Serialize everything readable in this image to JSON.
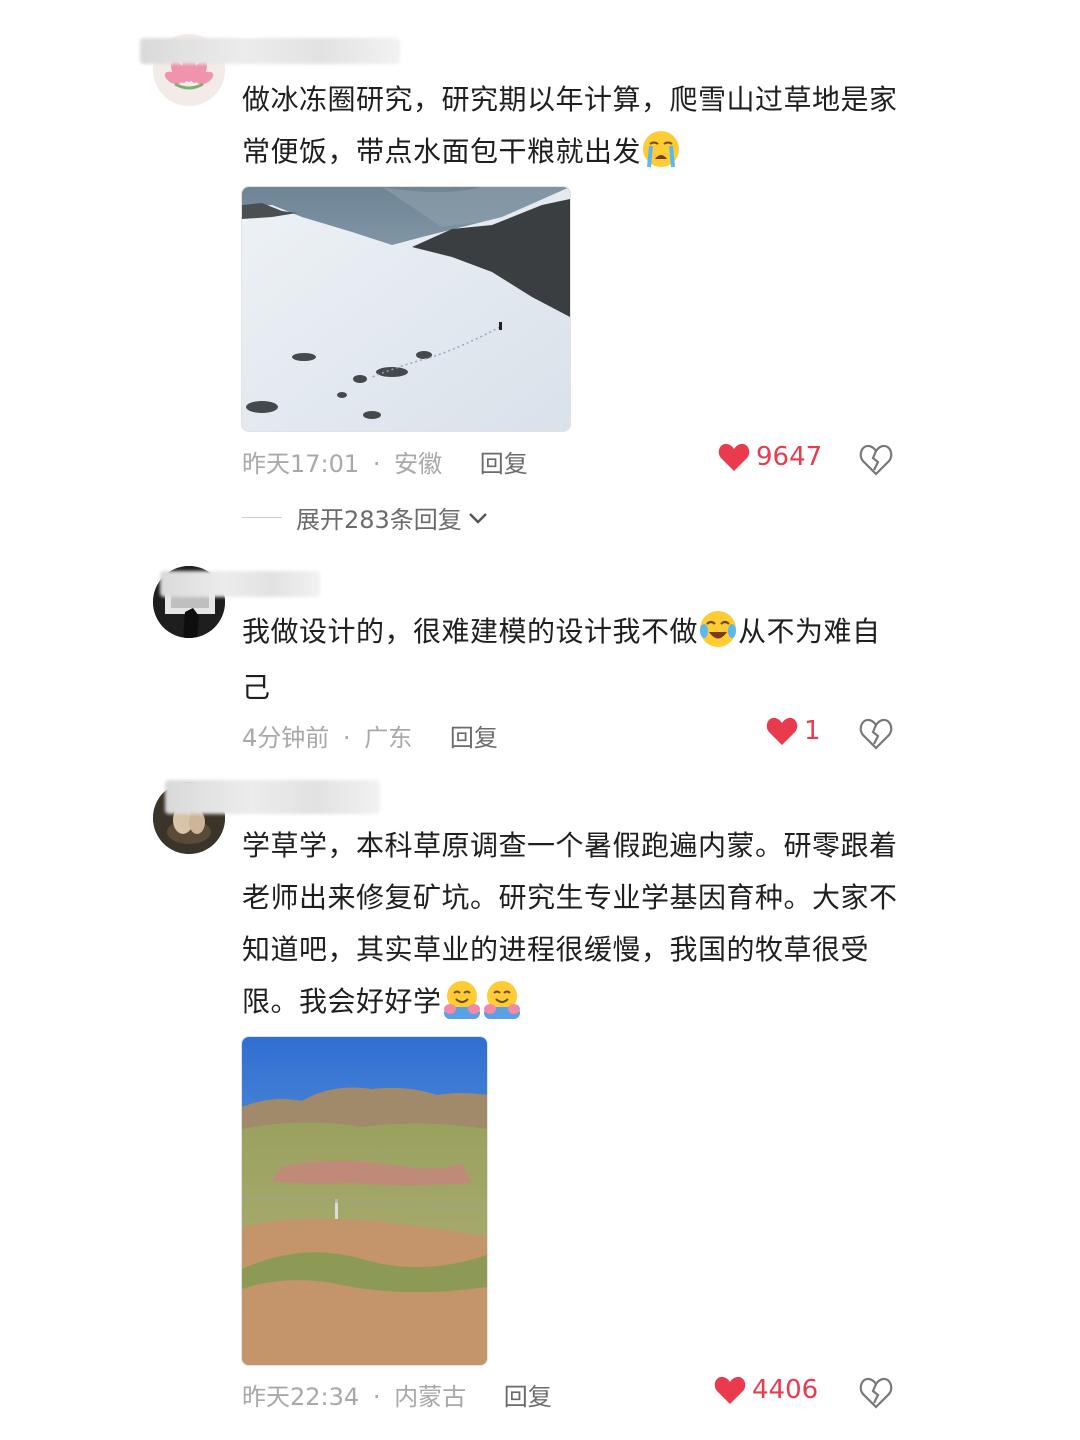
{
  "comments": [
    {
      "text_parts": [
        "做冰冻圈研究，研究期以年计算，爬雪山过草地是家常便饭，带点水面包干粮就出发"
      ],
      "emoji": "loudly-crying-face",
      "time": "昨天17:01",
      "sep": "·",
      "location": "安徽",
      "reply_label": "回复",
      "likes": "9647",
      "expand_label": "展开283条回复"
    },
    {
      "text_before": "我做设计的，很难建模的设计我不做",
      "emoji": "crying-laughing-face",
      "text_after": "从不为难自己",
      "time": "4分钟前",
      "sep": "·",
      "location": "广东",
      "reply_label": "回复",
      "likes": "1"
    },
    {
      "text": "学草学，本科草原调查一个暑假跑遍内蒙。研零跟着老师出来修复矿坑。研究生专业学基因育种。大家不知道吧，其实草业的进程很缓慢，我国的牧草很受限。我会好好学",
      "emoji": "hugging-face",
      "time": "昨天22:34",
      "sep": "·",
      "location": "内蒙古",
      "reply_label": "回复",
      "likes": "4406"
    }
  ],
  "colors": {
    "like_red": "#ea3a4e",
    "meta_gray": "#a8a8a8",
    "text": "#1f1f1f"
  },
  "icons": {
    "like": "heart-icon",
    "dislike": "broken-heart-icon",
    "expand": "chevron-down-icon"
  }
}
